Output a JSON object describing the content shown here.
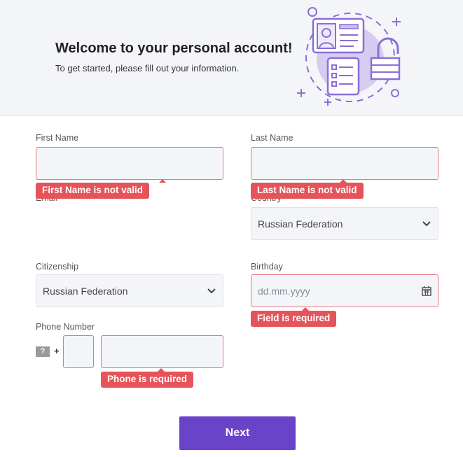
{
  "header": {
    "title": "Welcome to your personal account!",
    "subtitle": "To get started, please fill out your information."
  },
  "form": {
    "first_name": {
      "label": "First Name",
      "value": "",
      "error": "First Name is not valid"
    },
    "last_name": {
      "label": "Last Name",
      "value": "",
      "error": "Last Name is not valid"
    },
    "email": {
      "label": "Email"
    },
    "country": {
      "label": "Country",
      "value": "Russian Federation"
    },
    "citizenship": {
      "label": "Citizenship",
      "value": "Russian Federation"
    },
    "birthday": {
      "label": "Birthday",
      "placeholder": "dd.mm.yyyy",
      "error": "Field is required"
    },
    "phone": {
      "label": "Phone Number",
      "flag": "?",
      "plus": "+",
      "error": "Phone is required"
    }
  },
  "next_label": "Next",
  "colors": {
    "accent": "#6a44c8",
    "error": "#e5545a"
  }
}
